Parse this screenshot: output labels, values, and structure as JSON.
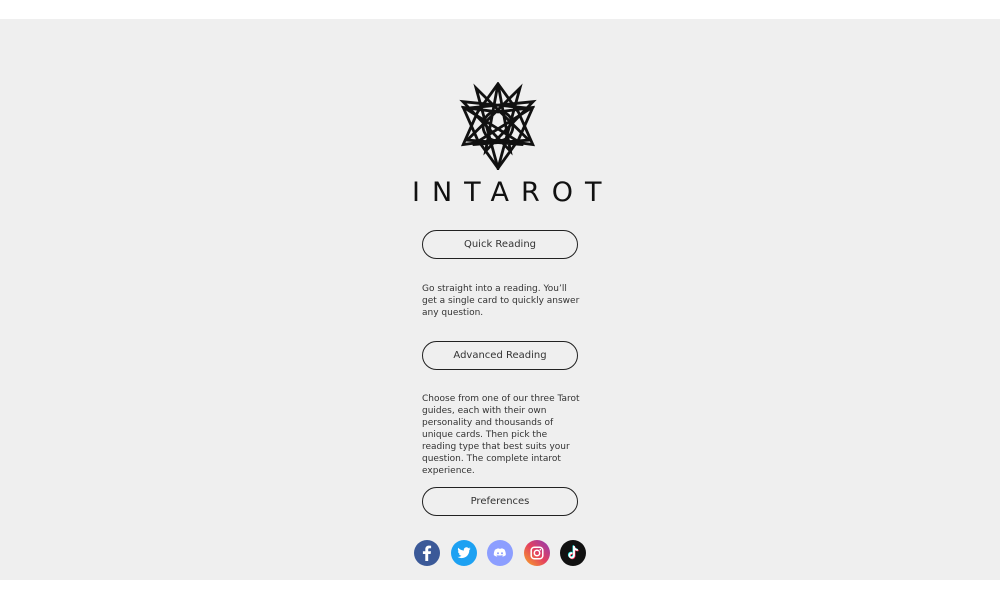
{
  "brand": {
    "name": "INTAROT"
  },
  "menu": [
    {
      "label": "Quick Reading",
      "description": "Go straight into a reading. You’ll get a single card to quickly answer any question."
    },
    {
      "label": "Advanced Reading",
      "description": "Choose from one of our three Tarot guides, each with their own personality and thousands of unique cards. Then pick the reading type that best suits your question. The complete intarot experience."
    },
    {
      "label": "Preferences"
    }
  ],
  "social": [
    {
      "icon": "facebook-icon",
      "color": "#3b5998"
    },
    {
      "icon": "twitter-icon",
      "color": "#1da1f2"
    },
    {
      "icon": "discord-icon",
      "color": "#8c9eff"
    },
    {
      "icon": "instagram-icon",
      "color": "#d62976"
    },
    {
      "icon": "tiktok-icon",
      "color": "#111111"
    }
  ],
  "colors": {
    "background": "#efefef",
    "ink": "#111111"
  }
}
